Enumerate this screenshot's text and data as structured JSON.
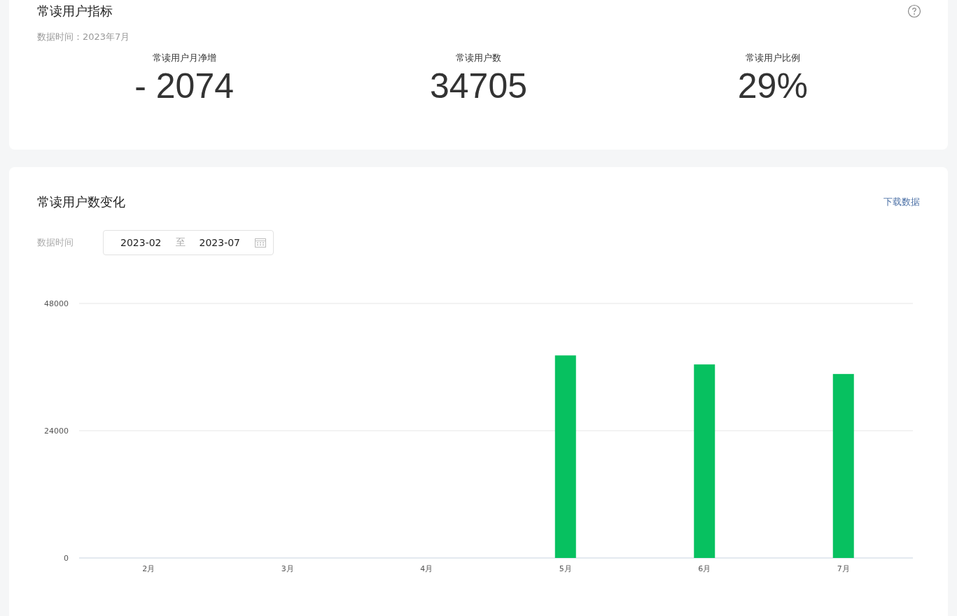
{
  "overview": {
    "title": "常读用户指标",
    "data_time": "数据时间：2023年7月",
    "metrics": [
      {
        "label": "常读用户月净增",
        "value": "- 2074"
      },
      {
        "label": "常读用户数",
        "value": "34705"
      },
      {
        "label": "常读用户比例",
        "value": "29%"
      }
    ]
  },
  "trend": {
    "title": "常读用户数变化",
    "download_link": "下载数据",
    "range_label": "数据时间",
    "range": {
      "start": "2023-02",
      "separator": "至",
      "end": "2023-07"
    },
    "chart_data": {
      "type": "bar",
      "categories": [
        "2月",
        "3月",
        "4月",
        "5月",
        "6月",
        "7月"
      ],
      "series": [
        {
          "color": "#07c160",
          "values": [
            0,
            0,
            0,
            38200,
            36500,
            34700
          ]
        }
      ],
      "ylim": [
        0,
        48000
      ],
      "yticks": [
        0,
        24000,
        48000
      ]
    }
  }
}
